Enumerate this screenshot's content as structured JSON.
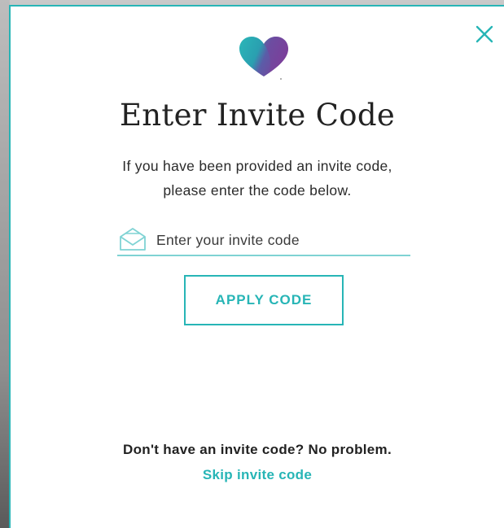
{
  "modal": {
    "title": "Enter Invite Code",
    "description_line1": "If you have been provided an invite code,",
    "description_line2": "please enter the code below.",
    "input": {
      "value": "",
      "placeholder": "Enter your invite code"
    },
    "apply_label": "APPLY CODE",
    "no_code_text": "Don't have an invite code? No problem.",
    "skip_label": "Skip invite code"
  },
  "icons": {
    "close": "close-icon",
    "logo": "heart-logo-icon",
    "envelope": "envelope-icon"
  },
  "colors": {
    "accent": "#27b5b6",
    "input_underline": "#7fd3d4",
    "text": "#222222",
    "logo_teal": "#2ab7b8",
    "logo_purple": "#7b3f9a"
  }
}
